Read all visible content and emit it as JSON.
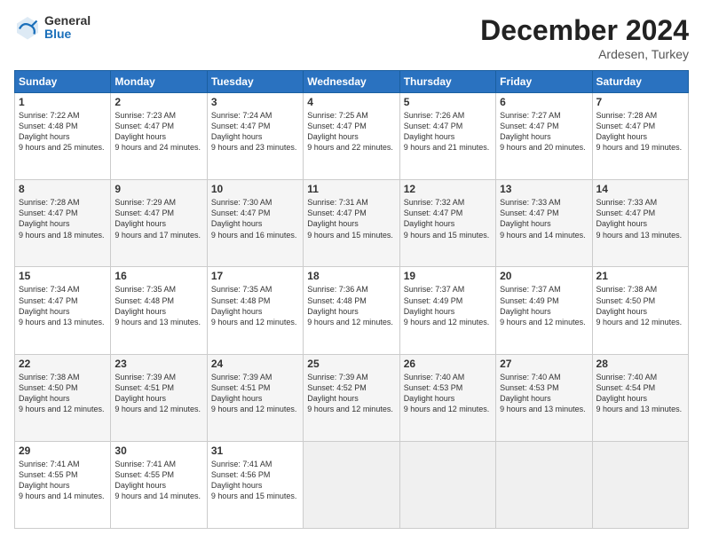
{
  "header": {
    "logo_general": "General",
    "logo_blue": "Blue",
    "month_title": "December 2024",
    "location": "Ardesen, Turkey"
  },
  "weekdays": [
    "Sunday",
    "Monday",
    "Tuesday",
    "Wednesday",
    "Thursday",
    "Friday",
    "Saturday"
  ],
  "weeks": [
    [
      {
        "day": "1",
        "sunrise": "7:22 AM",
        "sunset": "4:48 PM",
        "daylight": "9 hours and 25 minutes."
      },
      {
        "day": "2",
        "sunrise": "7:23 AM",
        "sunset": "4:47 PM",
        "daylight": "9 hours and 24 minutes."
      },
      {
        "day": "3",
        "sunrise": "7:24 AM",
        "sunset": "4:47 PM",
        "daylight": "9 hours and 23 minutes."
      },
      {
        "day": "4",
        "sunrise": "7:25 AM",
        "sunset": "4:47 PM",
        "daylight": "9 hours and 22 minutes."
      },
      {
        "day": "5",
        "sunrise": "7:26 AM",
        "sunset": "4:47 PM",
        "daylight": "9 hours and 21 minutes."
      },
      {
        "day": "6",
        "sunrise": "7:27 AM",
        "sunset": "4:47 PM",
        "daylight": "9 hours and 20 minutes."
      },
      {
        "day": "7",
        "sunrise": "7:28 AM",
        "sunset": "4:47 PM",
        "daylight": "9 hours and 19 minutes."
      }
    ],
    [
      {
        "day": "8",
        "sunrise": "7:28 AM",
        "sunset": "4:47 PM",
        "daylight": "9 hours and 18 minutes."
      },
      {
        "day": "9",
        "sunrise": "7:29 AM",
        "sunset": "4:47 PM",
        "daylight": "9 hours and 17 minutes."
      },
      {
        "day": "10",
        "sunrise": "7:30 AM",
        "sunset": "4:47 PM",
        "daylight": "9 hours and 16 minutes."
      },
      {
        "day": "11",
        "sunrise": "7:31 AM",
        "sunset": "4:47 PM",
        "daylight": "9 hours and 15 minutes."
      },
      {
        "day": "12",
        "sunrise": "7:32 AM",
        "sunset": "4:47 PM",
        "daylight": "9 hours and 15 minutes."
      },
      {
        "day": "13",
        "sunrise": "7:33 AM",
        "sunset": "4:47 PM",
        "daylight": "9 hours and 14 minutes."
      },
      {
        "day": "14",
        "sunrise": "7:33 AM",
        "sunset": "4:47 PM",
        "daylight": "9 hours and 13 minutes."
      }
    ],
    [
      {
        "day": "15",
        "sunrise": "7:34 AM",
        "sunset": "4:47 PM",
        "daylight": "9 hours and 13 minutes."
      },
      {
        "day": "16",
        "sunrise": "7:35 AM",
        "sunset": "4:48 PM",
        "daylight": "9 hours and 13 minutes."
      },
      {
        "day": "17",
        "sunrise": "7:35 AM",
        "sunset": "4:48 PM",
        "daylight": "9 hours and 12 minutes."
      },
      {
        "day": "18",
        "sunrise": "7:36 AM",
        "sunset": "4:48 PM",
        "daylight": "9 hours and 12 minutes."
      },
      {
        "day": "19",
        "sunrise": "7:37 AM",
        "sunset": "4:49 PM",
        "daylight": "9 hours and 12 minutes."
      },
      {
        "day": "20",
        "sunrise": "7:37 AM",
        "sunset": "4:49 PM",
        "daylight": "9 hours and 12 minutes."
      },
      {
        "day": "21",
        "sunrise": "7:38 AM",
        "sunset": "4:50 PM",
        "daylight": "9 hours and 12 minutes."
      }
    ],
    [
      {
        "day": "22",
        "sunrise": "7:38 AM",
        "sunset": "4:50 PM",
        "daylight": "9 hours and 12 minutes."
      },
      {
        "day": "23",
        "sunrise": "7:39 AM",
        "sunset": "4:51 PM",
        "daylight": "9 hours and 12 minutes."
      },
      {
        "day": "24",
        "sunrise": "7:39 AM",
        "sunset": "4:51 PM",
        "daylight": "9 hours and 12 minutes."
      },
      {
        "day": "25",
        "sunrise": "7:39 AM",
        "sunset": "4:52 PM",
        "daylight": "9 hours and 12 minutes."
      },
      {
        "day": "26",
        "sunrise": "7:40 AM",
        "sunset": "4:53 PM",
        "daylight": "9 hours and 12 minutes."
      },
      {
        "day": "27",
        "sunrise": "7:40 AM",
        "sunset": "4:53 PM",
        "daylight": "9 hours and 13 minutes."
      },
      {
        "day": "28",
        "sunrise": "7:40 AM",
        "sunset": "4:54 PM",
        "daylight": "9 hours and 13 minutes."
      }
    ],
    [
      {
        "day": "29",
        "sunrise": "7:41 AM",
        "sunset": "4:55 PM",
        "daylight": "9 hours and 14 minutes."
      },
      {
        "day": "30",
        "sunrise": "7:41 AM",
        "sunset": "4:55 PM",
        "daylight": "9 hours and 14 minutes."
      },
      {
        "day": "31",
        "sunrise": "7:41 AM",
        "sunset": "4:56 PM",
        "daylight": "9 hours and 15 minutes."
      },
      null,
      null,
      null,
      null
    ]
  ]
}
